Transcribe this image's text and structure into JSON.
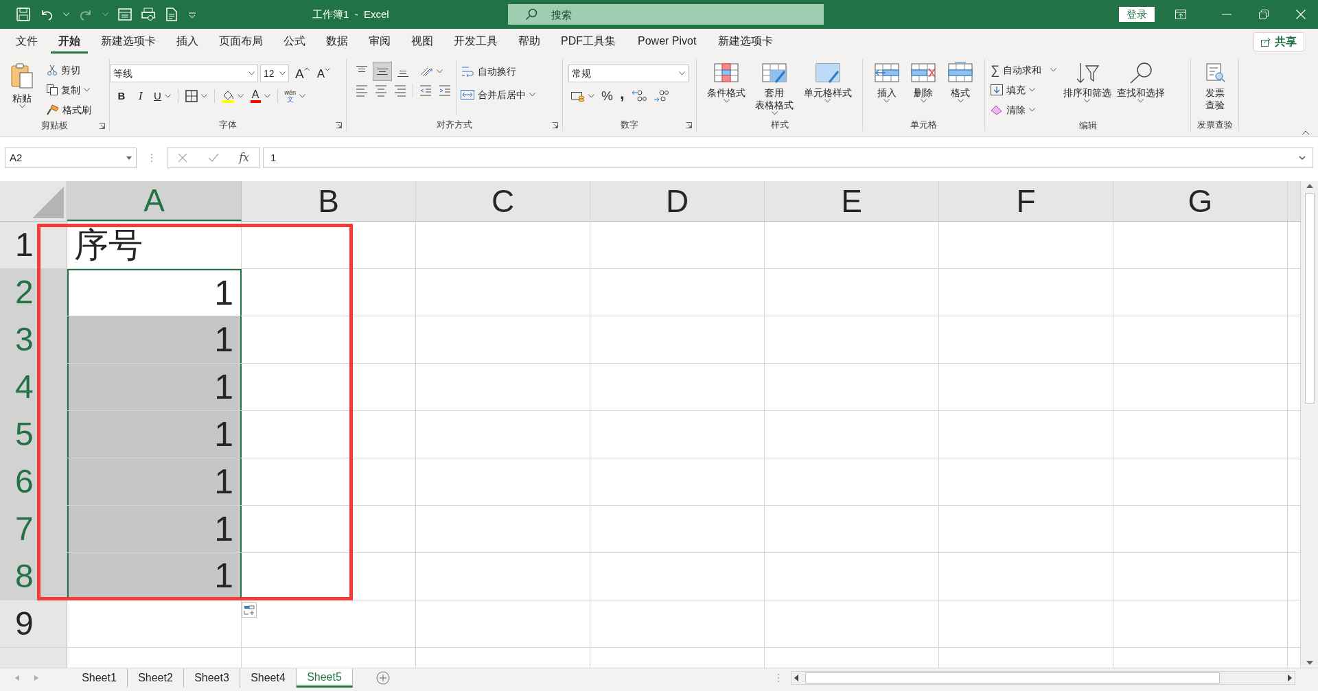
{
  "title_bar": {
    "title": "工作簿1  -  Excel",
    "search": {
      "placeholder": "搜索"
    },
    "login": "登录"
  },
  "menu_tabs": [
    {
      "label": "文件",
      "selected": false
    },
    {
      "label": "开始",
      "selected": true
    },
    {
      "label": "新建选项卡",
      "selected": false
    },
    {
      "label": "插入",
      "selected": false
    },
    {
      "label": "页面布局",
      "selected": false
    },
    {
      "label": "公式",
      "selected": false
    },
    {
      "label": "数据",
      "selected": false
    },
    {
      "label": "审阅",
      "selected": false
    },
    {
      "label": "视图",
      "selected": false
    },
    {
      "label": "开发工具",
      "selected": false
    },
    {
      "label": "帮助",
      "selected": false
    },
    {
      "label": "PDF工具集",
      "selected": false
    },
    {
      "label": "Power Pivot",
      "selected": false
    },
    {
      "label": "新建选项卡",
      "selected": false
    }
  ],
  "share": "共享",
  "ribbon": {
    "clipboard": {
      "label": "剪贴板",
      "paste": "粘贴",
      "cut": "剪切",
      "copy": "复制",
      "format_painter": "格式刷"
    },
    "font": {
      "label": "字体",
      "font_name": "等线",
      "font_size": "12",
      "grow": "A",
      "shrink": "A",
      "bold": "B",
      "italic": "I",
      "underline": "U",
      "font_color": "A",
      "phonetic": [
        "wén",
        "文"
      ]
    },
    "alignment": {
      "label": "对齐方式",
      "vertical_align": [
        {
          "selected": false
        },
        {
          "selected": true
        },
        {
          "selected": false
        }
      ],
      "wrap_text": "自动换行",
      "merge_center": "合并后居中"
    },
    "number": {
      "label": "数字",
      "format": "常规",
      "percent": "%",
      "comma": ","
    },
    "styles": {
      "label": "样式",
      "conditional": "条件格式",
      "table_format": [
        "套用",
        "表格格式"
      ],
      "cell_styles": "单元格样式"
    },
    "cells": {
      "label": "单元格",
      "insert": "插入",
      "delete": "删除",
      "format": "格式"
    },
    "editing": {
      "label": "编辑",
      "sigma": "∑",
      "autosum": "自动求和",
      "fill": "填充",
      "clear": "清除",
      "sort_filter": "排序和筛选",
      "find_select": "查找和选择"
    },
    "invoice": {
      "label": "发票查验",
      "button": [
        "发票",
        "查验"
      ]
    }
  },
  "formula_bar": {
    "name_box": "A2",
    "fx": "fx",
    "value": "1"
  },
  "columns": [
    {
      "label": "A",
      "selected": true
    },
    {
      "label": "B",
      "selected": false
    },
    {
      "label": "C",
      "selected": false
    },
    {
      "label": "D",
      "selected": false
    },
    {
      "label": "E",
      "selected": false
    },
    {
      "label": "F",
      "selected": false
    },
    {
      "label": "G",
      "selected": false
    }
  ],
  "rows": [
    {
      "header": "1",
      "selected": false,
      "cells": [
        {
          "text": "序号",
          "kind": "text",
          "selected": false,
          "active": false
        }
      ]
    },
    {
      "header": "2",
      "selected": true,
      "cells": [
        {
          "text": "1",
          "kind": "number",
          "selected": false,
          "active": true
        }
      ]
    },
    {
      "header": "3",
      "selected": true,
      "cells": [
        {
          "text": "1",
          "kind": "number",
          "selected": true,
          "active": false
        }
      ]
    },
    {
      "header": "4",
      "selected": true,
      "cells": [
        {
          "text": "1",
          "kind": "number",
          "selected": true,
          "active": false
        }
      ]
    },
    {
      "header": "5",
      "selected": true,
      "cells": [
        {
          "text": "1",
          "kind": "number",
          "selected": true,
          "active": false
        }
      ]
    },
    {
      "header": "6",
      "selected": true,
      "cells": [
        {
          "text": "1",
          "kind": "number",
          "selected": true,
          "active": false
        }
      ]
    },
    {
      "header": "7",
      "selected": true,
      "cells": [
        {
          "text": "1",
          "kind": "number",
          "selected": true,
          "active": false
        }
      ]
    },
    {
      "header": "8",
      "selected": true,
      "cells": [
        {
          "text": "1",
          "kind": "number",
          "selected": true,
          "active": false
        }
      ]
    },
    {
      "header": "9",
      "selected": false,
      "cells": []
    }
  ],
  "sheet_tabs": [
    {
      "label": "Sheet1",
      "selected": false
    },
    {
      "label": "Sheet2",
      "selected": false
    },
    {
      "label": "Sheet3",
      "selected": false
    },
    {
      "label": "Sheet4",
      "selected": false
    },
    {
      "label": "Sheet5",
      "selected": true
    }
  ]
}
